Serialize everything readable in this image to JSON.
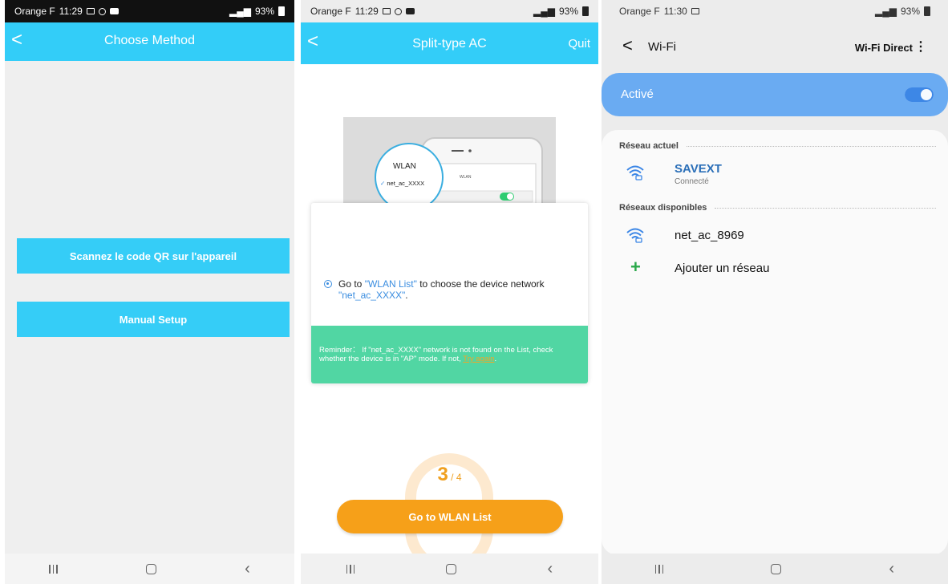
{
  "p1": {
    "status": {
      "carrier": "Orange F",
      "time": "11:29",
      "battery": "93%"
    },
    "title": "Choose Method",
    "buttons": {
      "scan": "Scannez le code QR sur l'appareil",
      "manual": "Manual Setup"
    }
  },
  "p2": {
    "status": {
      "carrier": "Orange F",
      "time": "11:29",
      "battery": "93%"
    },
    "title": "Split-type AC",
    "quit": "Quit",
    "illustration": {
      "wlan": "WLAN",
      "network": "net_ac_XXXX",
      "wlan_small": "WLAN"
    },
    "step": {
      "prefix": "Go to ",
      "link": "\"WLAN List\"",
      "middle": " to choose the device network ",
      "network": "\"net_ac_XXXX\"",
      "suffix": "."
    },
    "reminder": {
      "text": "Reminder：  If \"net_ac_XXXX\" network is not found on the List, check whether the device is in \"AP\" mode. If not, ",
      "link": "Try again",
      "end": "."
    },
    "progress": {
      "current": "3",
      "total": "4"
    },
    "go_button": "Go to WLAN List"
  },
  "p3": {
    "status": {
      "carrier": "Orange F",
      "time": "11:30",
      "battery": "93%"
    },
    "title": "Wi-Fi",
    "wifi_direct": "Wi-Fi Direct",
    "active_label": "Activé",
    "current_header": "Réseau actuel",
    "current_network": {
      "name": "SAVEXT",
      "status": "Connecté"
    },
    "available_header": "Réseaux disponibles",
    "available_networks": [
      {
        "name": "net_ac_8969"
      }
    ],
    "add_network": "Ajouter un réseau"
  },
  "colors": {
    "accent_blue": "#33cdf8",
    "orange": "#f6a019",
    "reminder_green": "#51d6a3",
    "wifi_active": "#6aabf2"
  }
}
